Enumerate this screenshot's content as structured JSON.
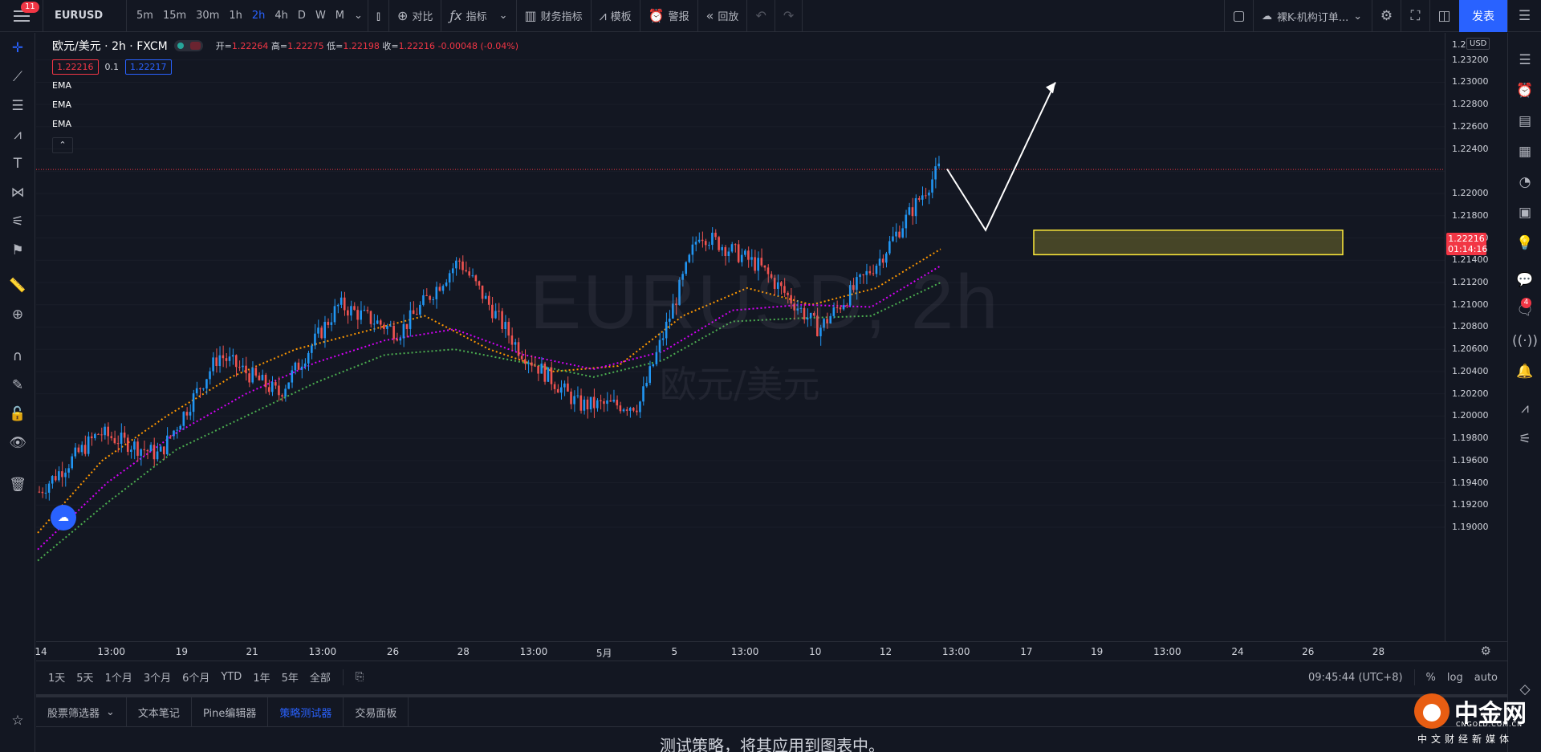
{
  "topbar": {
    "badge": "11",
    "symbol": "EURUSD",
    "timeframes": [
      "5m",
      "15m",
      "30m",
      "1h",
      "2h",
      "4h",
      "D",
      "W",
      "M"
    ],
    "active_timeframe": "2h",
    "compare": "对比",
    "indicators": "指标",
    "financials": "财务指标",
    "templates": "模板",
    "alert": "警报",
    "replay": "回放",
    "template_select": "裸K-机构订单...",
    "publish": "发表"
  },
  "legend": {
    "title": "欧元/美元 · 2h · FXCM",
    "open_label": "开=",
    "open": "1.22264",
    "high_label": "高=",
    "high": "1.22275",
    "low_label": "低=",
    "low": "1.22198",
    "close_label": "收=",
    "close": "1.22216",
    "change": "-0.00048 (-0.04%)",
    "bid": "1.22216",
    "spread": "0.1",
    "ask": "1.22217",
    "indicators": [
      "EMA",
      "EMA",
      "EMA"
    ],
    "collapse": "⌃"
  },
  "watermark": {
    "symbol": "EURUSD, 2h",
    "name": "欧元/美元"
  },
  "price_axis": {
    "currency": "USD",
    "ticks": [
      "1.2",
      "1.23200",
      "1.23000",
      "1.22800",
      "1.22600",
      "1.22400",
      "1.22000",
      "1.21800",
      "1.21600",
      "1.21400",
      "1.21200",
      "1.21000",
      "1.20800",
      "1.20600",
      "1.20400",
      "1.20200",
      "1.20000",
      "1.19800",
      "1.19600",
      "1.19400",
      "1.19200",
      "1.19000"
    ],
    "last_price": "1.22216",
    "countdown": "01:14:16"
  },
  "time_axis": {
    "ticks": [
      "14",
      "13:00",
      "19",
      "21",
      "13:00",
      "26",
      "28",
      "13:00",
      "5月",
      "5",
      "13:00",
      "10",
      "12",
      "13:00",
      "17",
      "19",
      "13:00",
      "24",
      "26",
      "28"
    ]
  },
  "range_bar": {
    "ranges": [
      "1天",
      "5天",
      "1个月",
      "3个月",
      "6个月",
      "YTD",
      "1年",
      "5年",
      "全部"
    ],
    "time": "09:45:44 (UTC+8)",
    "percent": "%",
    "log": "log",
    "auto": "auto"
  },
  "bottom_tabs": {
    "tabs": [
      "股票筛选器",
      "文本笔记",
      "Pine编辑器",
      "策略测试器",
      "交易面板"
    ],
    "active": "策略测试器",
    "message": "测试策略，将其应用到图表中。"
  },
  "brand": {
    "name": "中金网",
    "url": "CNGOLD.COM.CN",
    "tagline": "中文财经新媒体"
  },
  "right_sidebar": {
    "chat_badge": "4"
  },
  "colors": {
    "background": "#131722",
    "up": "#2196f3",
    "down": "#ef5350",
    "ema_fast": "#ff9800",
    "ema_mid": "#d500f9",
    "ema_slow": "#4caf50",
    "zone": "#ffeb3b",
    "accent": "#2962ff",
    "last_price": "#f23645"
  },
  "chart_data": {
    "type": "candlestick",
    "symbol": "EURUSD",
    "interval": "2h",
    "y_range": [
      1.19,
      1.234
    ],
    "last_price": 1.22216,
    "supply_demand_zone": [
      1.2145,
      1.2167
    ],
    "projection_arrow": [
      1.2222,
      1.2167,
      1.23
    ],
    "key_points": [
      {
        "x": "14",
        "y": 1.1932
      },
      {
        "x": "13:00",
        "y": 1.1985
      },
      {
        "x": "19",
        "y": 1.1965
      },
      {
        "x": "21",
        "y": 1.2055
      },
      {
        "x": "13:00",
        "y": 1.202
      },
      {
        "x": "26",
        "y": 1.21
      },
      {
        "x": "28",
        "y": 1.2075
      },
      {
        "x": "13:00",
        "y": 1.214
      },
      {
        "x": "5月",
        "y": 1.206
      },
      {
        "x": "5",
        "y": 1.201
      },
      {
        "x": "13:00",
        "y": 1.201
      },
      {
        "x": "10",
        "y": 1.2165
      },
      {
        "x": "12",
        "y": 1.2135
      },
      {
        "x": "13:00",
        "y": 1.2078
      },
      {
        "x": "17",
        "y": 1.214
      },
      {
        "x": "19",
        "y": 1.2222
      }
    ],
    "ema_fast": [
      1.1895,
      1.196,
      1.2,
      1.2035,
      1.206,
      1.2075,
      1.209,
      1.206,
      1.204,
      1.2045,
      1.209,
      1.2115,
      1.21,
      1.2115,
      1.215
    ],
    "ema_mid": [
      1.188,
      1.194,
      1.1985,
      1.202,
      1.2048,
      1.2068,
      1.2078,
      1.2055,
      1.2042,
      1.2058,
      1.2095,
      1.21,
      1.2098,
      1.2135
    ],
    "ema_slow": [
      1.187,
      1.1922,
      1.197,
      1.2,
      1.203,
      1.2055,
      1.206,
      1.2048,
      1.2035,
      1.205,
      1.2085,
      1.2088,
      1.209,
      1.212
    ]
  }
}
